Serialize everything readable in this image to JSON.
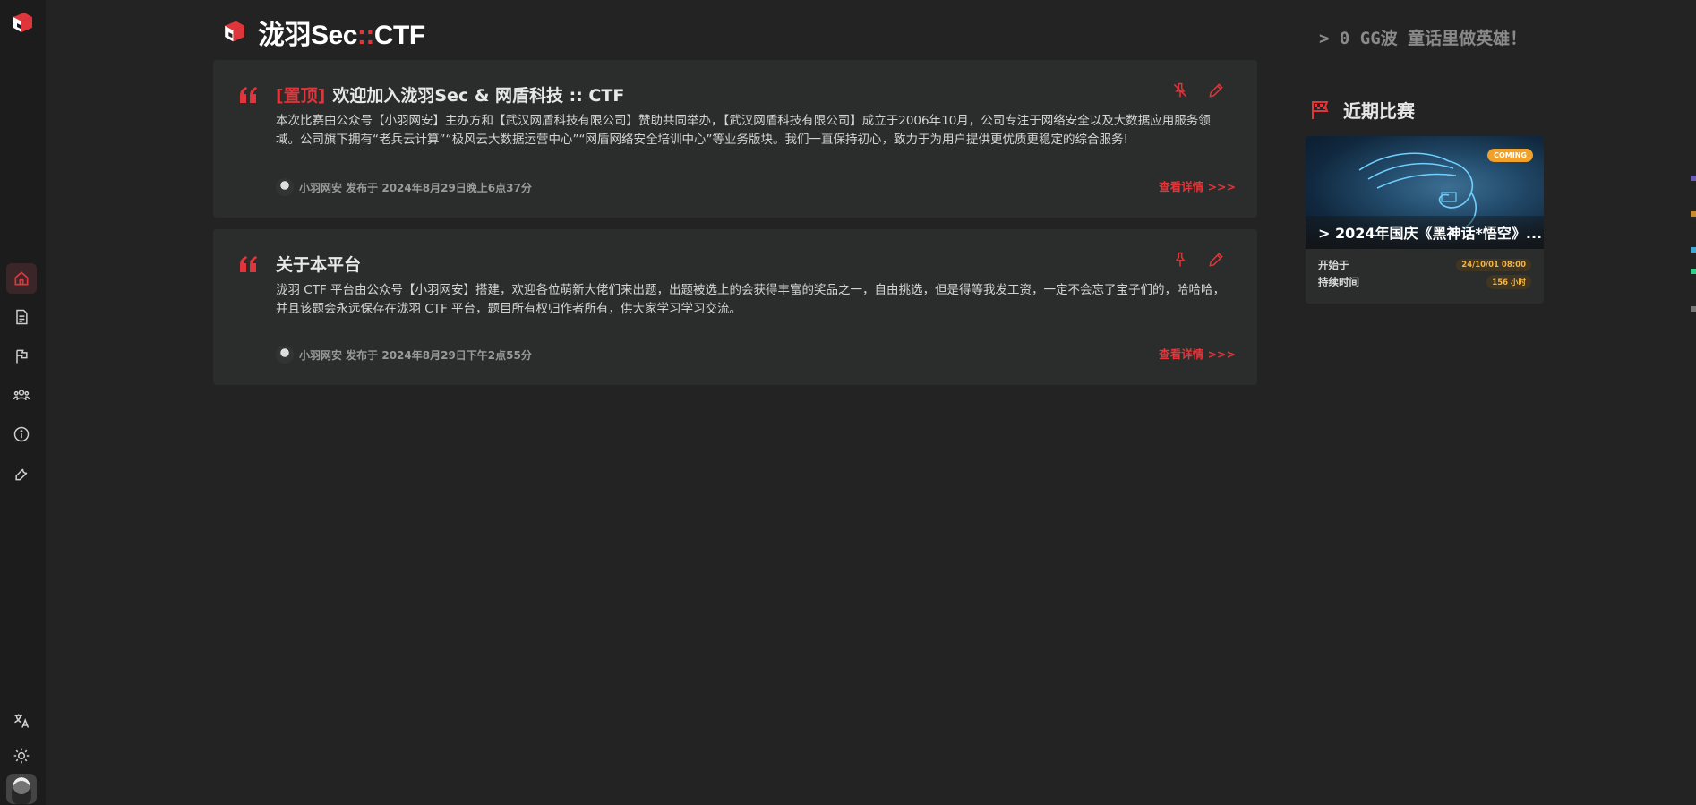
{
  "brand": {
    "name_a": "泷羽Sec",
    "sep": "::",
    "name_b": "CTF"
  },
  "motto": "> 0 GG波 童话里做英雄！",
  "sidebar": {
    "items": [
      {
        "name": "home"
      },
      {
        "name": "notices"
      },
      {
        "name": "challenges"
      },
      {
        "name": "users"
      },
      {
        "name": "about"
      },
      {
        "name": "tools"
      }
    ]
  },
  "notices": [
    {
      "pin_tag": "[置顶]",
      "title": "欢迎加入泷羽Sec & 网盾科技 :: CTF",
      "body": "本次比赛由公众号【小羽网安】主办方和【武汉网盾科技有限公司】赞助共同举办，【武汉网盾科技有限公司】成立于2006年10月，公司专注于网络安全以及大数据应用服务领域。公司旗下拥有“老兵云计算”“极风云大数据运营中心”“网盾网络安全培训中心”等业务版块。我们一直保持初心，致力于为用户提供更优质更稳定的综合服务!",
      "meta": "小羽网安 发布于 2024年8月29日晚上6点37分",
      "link": "查看详情 >>>"
    },
    {
      "pin_tag": "",
      "title": "关于本平台",
      "body": "泷羽 CTF 平台由公众号【小羽网安】搭建，欢迎各位萌新大佬们来出题，出题被选上的会获得丰富的奖品之一，自由挑选，但是得等我发工资，一定不会忘了宝子们的，哈哈哈，并且该题会永远保存在泷羽 CTF 平台，题目所有权归作者所有，供大家学习学习交流。",
      "meta": "小羽网安 发布于 2024年8月29日下午2点55分",
      "link": "查看详情 >>>"
    }
  ],
  "recent": {
    "title": "近期比赛",
    "match": {
      "badge": "COMING",
      "name": "> 2024年国庆《黑神话*悟空》...",
      "start_label": "开始于",
      "start_value": "24/10/01 08:00",
      "duration_label": "持续时间",
      "duration_value": "156 小时"
    }
  },
  "colors": {
    "accent": "#e0353a",
    "bg": "#232323",
    "card": "#2b2c2c",
    "badge": "#f0a12a"
  }
}
